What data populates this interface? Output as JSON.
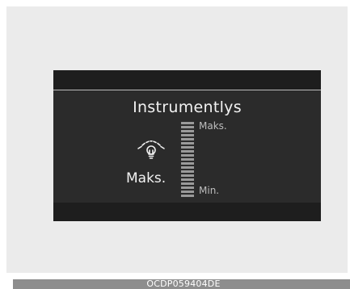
{
  "display": {
    "title": "Instrumentlys",
    "current_value": "Maks.",
    "scale_max_label": "Maks.",
    "scale_min_label": "Min.",
    "level_fraction": 1.0,
    "icon": "instrument-illumination-icon"
  },
  "footer": {
    "code": "OCDP059404DE"
  },
  "colors": {
    "background": "#ebebeb",
    "screen": "#2b2b2b",
    "text": "#f2f2f2",
    "bar_segment": "#9a9a9a",
    "footer": "#8d8d8d"
  }
}
